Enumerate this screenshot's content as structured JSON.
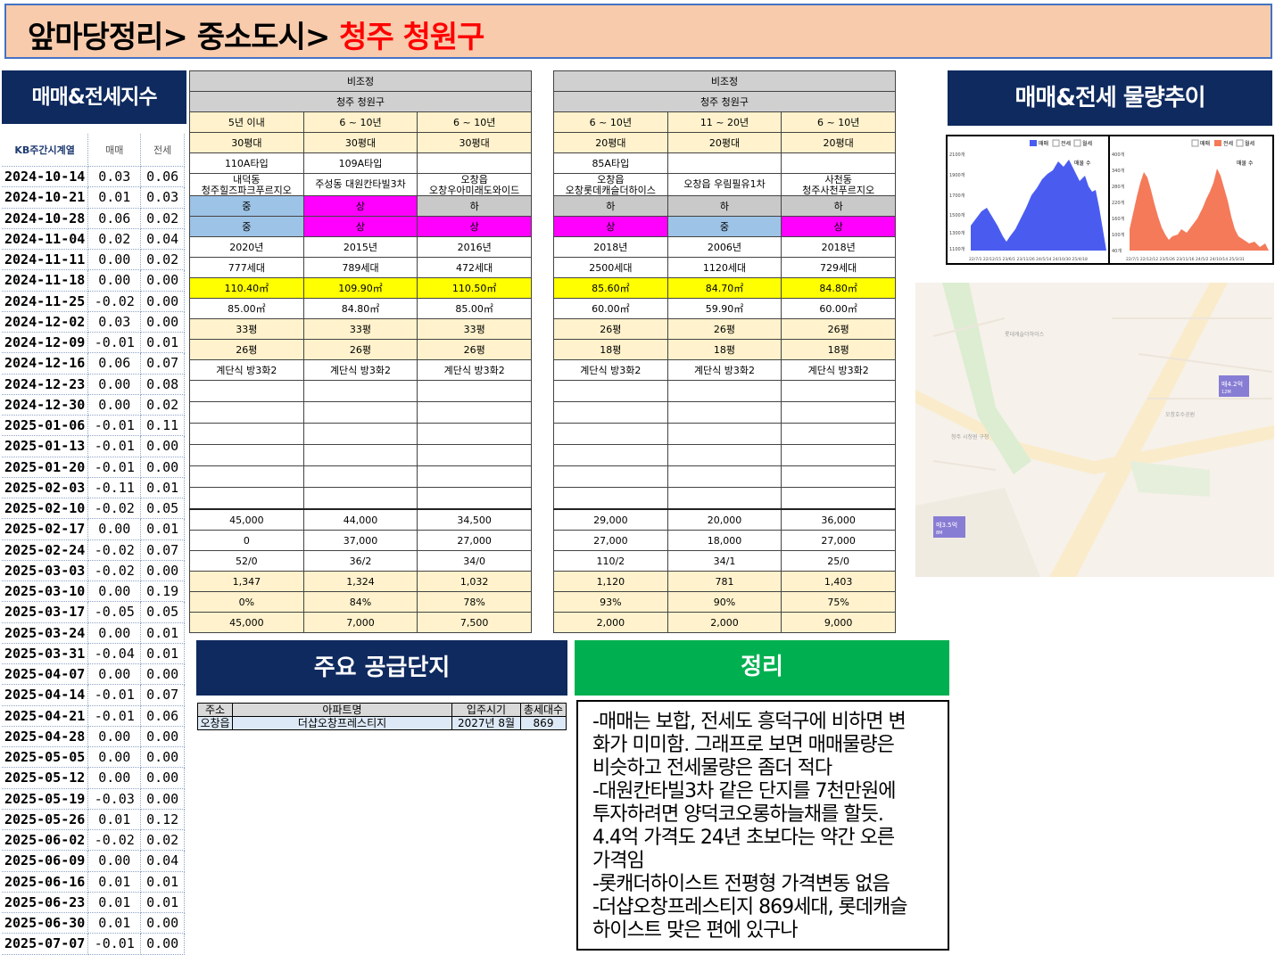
{
  "title": {
    "prefix": "앞마당정리> 중소도시> ",
    "highlight": "청주 청원구"
  },
  "index_panel": {
    "header": "매매&전세지수",
    "columns": [
      "KB주간시계열",
      "매매",
      "전세"
    ],
    "rows": [
      [
        "2024-10-14",
        "0.03",
        "0.06"
      ],
      [
        "2024-10-21",
        "0.01",
        "0.03"
      ],
      [
        "2024-10-28",
        "0.06",
        "0.02"
      ],
      [
        "2024-11-04",
        "0.02",
        "0.04"
      ],
      [
        "2024-11-11",
        "0.00",
        "0.02"
      ],
      [
        "2024-11-18",
        "0.00",
        "0.00"
      ],
      [
        "2024-11-25",
        "-0.02",
        "0.00"
      ],
      [
        "2024-12-02",
        "0.03",
        "0.00"
      ],
      [
        "2024-12-09",
        "-0.01",
        "0.01"
      ],
      [
        "2024-12-16",
        "0.06",
        "0.07"
      ],
      [
        "2024-12-23",
        "0.00",
        "0.08"
      ],
      [
        "2024-12-30",
        "0.00",
        "0.02"
      ],
      [
        "2025-01-06",
        "-0.01",
        "0.11"
      ],
      [
        "2025-01-13",
        "-0.01",
        "0.00"
      ],
      [
        "2025-01-20",
        "-0.01",
        "0.00"
      ],
      [
        "2025-02-03",
        "-0.11",
        "0.01"
      ],
      [
        "2025-02-10",
        "-0.02",
        "0.05"
      ],
      [
        "2025-02-17",
        "0.00",
        "0.01"
      ],
      [
        "2025-02-24",
        "-0.02",
        "0.07"
      ],
      [
        "2025-03-03",
        "-0.02",
        "0.00"
      ],
      [
        "2025-03-10",
        "0.00",
        "0.19"
      ],
      [
        "2025-03-17",
        "-0.05",
        "0.05"
      ],
      [
        "2025-03-24",
        "0.00",
        "0.01"
      ],
      [
        "2025-03-31",
        "-0.04",
        "0.01"
      ],
      [
        "2025-04-07",
        "0.00",
        "0.00"
      ],
      [
        "2025-04-14",
        "-0.01",
        "0.07"
      ],
      [
        "2025-04-21",
        "-0.01",
        "0.06"
      ],
      [
        "2025-04-28",
        "0.00",
        "0.00"
      ],
      [
        "2025-05-05",
        "0.00",
        "0.00"
      ],
      [
        "2025-05-12",
        "0.00",
        "0.00"
      ],
      [
        "2025-05-19",
        "-0.03",
        "0.00"
      ],
      [
        "2025-05-26",
        "0.01",
        "0.12"
      ],
      [
        "2025-06-02",
        "-0.02",
        "0.02"
      ],
      [
        "2025-06-09",
        "0.00",
        "0.04"
      ],
      [
        "2025-06-16",
        "0.01",
        "0.01"
      ],
      [
        "2025-06-23",
        "0.01",
        "0.01"
      ],
      [
        "2025-06-30",
        "0.01",
        "0.00"
      ],
      [
        "2025-07-07",
        "-0.01",
        "0.00"
      ]
    ]
  },
  "compare_a": {
    "group": "비조정",
    "region": "청주 청원구",
    "age": [
      "5년 이내",
      "6 ~ 10년",
      "6 ~ 10년"
    ],
    "size": [
      "30평대",
      "30평대",
      "30평대"
    ],
    "type": [
      "110A타입",
      "109A타입",
      ""
    ],
    "dong": [
      "내덕동",
      "주성동 대원칸타빌3차",
      "오창읍"
    ],
    "name": [
      "청주힐즈파크푸르지오",
      "",
      "오창우아미래도와이드"
    ],
    "grade1": [
      "중",
      "상",
      "하"
    ],
    "grade2": [
      "중",
      "상",
      "상"
    ],
    "year": [
      "2020년",
      "2015년",
      "2016년"
    ],
    "households": [
      "777세대",
      "789세대",
      "472세대"
    ],
    "supply_area": [
      "110.40㎡",
      "109.90㎡",
      "110.50㎡"
    ],
    "exclusive_area": [
      "85.00㎡",
      "84.80㎡",
      "85.00㎡"
    ],
    "supply_pyeong": [
      "33평",
      "33평",
      "33평"
    ],
    "exclusive_pyeong": [
      "26평",
      "26평",
      "26평"
    ],
    "structure": [
      "계단식 방3화2",
      "계단식 방3화2",
      "계단식 방3화2"
    ],
    "sale": [
      "45,000",
      "44,000",
      "34,500"
    ],
    "jeonse": [
      "0",
      "37,000",
      "27,000"
    ],
    "listings": [
      "52/0",
      "36/2",
      "34/0"
    ],
    "price_per": [
      "1,347",
      "1,324",
      "1,032"
    ],
    "ratio": [
      "0%",
      "84%",
      "78%"
    ],
    "gap": [
      "45,000",
      "7,000",
      "7,500"
    ]
  },
  "compare_b": {
    "group": "비조정",
    "region": "청주 청원구",
    "age": [
      "6 ~ 10년",
      "11 ~ 20년",
      "6 ~ 10년"
    ],
    "size": [
      "20평대",
      "20평대",
      "20평대"
    ],
    "type": [
      "85A타입",
      "",
      ""
    ],
    "dong": [
      "오창읍",
      "오창읍 우림필유1차",
      "사천동"
    ],
    "name": [
      "오창롯데캐슬더하이스",
      "",
      "청주사천푸르지오"
    ],
    "grade1": [
      "하",
      "하",
      "하"
    ],
    "grade2": [
      "상",
      "중",
      "상"
    ],
    "year": [
      "2018년",
      "2006년",
      "2018년"
    ],
    "households": [
      "2500세대",
      "1120세대",
      "729세대"
    ],
    "supply_area": [
      "85.60㎡",
      "84.70㎡",
      "84.80㎡"
    ],
    "exclusive_area": [
      "60.00㎡",
      "59.90㎡",
      "60.00㎡"
    ],
    "supply_pyeong": [
      "26평",
      "26평",
      "26평"
    ],
    "exclusive_pyeong": [
      "18평",
      "18평",
      "18평"
    ],
    "structure": [
      "계단식 방3화2",
      "계단식 방3화2",
      "계단식 방3화2"
    ],
    "sale": [
      "29,000",
      "20,000",
      "36,000"
    ],
    "jeonse": [
      "27,000",
      "18,000",
      "27,000"
    ],
    "listings": [
      "110/2",
      "34/1",
      "25/0"
    ],
    "price_per": [
      "1,120",
      "781",
      "1,403"
    ],
    "ratio": [
      "93%",
      "90%",
      "75%"
    ],
    "gap": [
      "2,000",
      "2,000",
      "9,000"
    ]
  },
  "trend": {
    "header": "매매&전세 물량추이",
    "chart1": {
      "legend": [
        "매매",
        "전세",
        "월세"
      ],
      "series_label": "매물 수",
      "y_ticks": [
        "2100개",
        "1900개",
        "1700개",
        "1500개",
        "1300개",
        "1100개"
      ],
      "x_label": "22/7/1 22/12/15 23/6/1 23/11/26 24/5/14 24/10/30 25/4/18",
      "color": "#4a5cf0"
    },
    "chart2": {
      "legend": [
        "매매",
        "전세",
        "월세"
      ],
      "series_label": "매물 수",
      "y_ticks": [
        "400개",
        "340개",
        "280개",
        "220개",
        "160개",
        "100개",
        "40개"
      ],
      "x_label": "22/7/1 22/12/12 23/5/26 23/11/16 24/5/2 24/10/14 25/3/31",
      "color": "#f47a5a"
    }
  },
  "map": {
    "pins": [
      {
        "label": "매4.2억",
        "sub": "12M"
      },
      {
        "label": "매3.5억",
        "sub": "8M"
      }
    ],
    "places": [
      "청주 시청원 구청",
      "오창호수공원",
      "롯데캐슬더하이스"
    ]
  },
  "supply": {
    "header": "주요 공급단지",
    "columns": [
      "주소",
      "아파트명",
      "입주시기",
      "총세대수"
    ],
    "rows": [
      [
        "오창읍",
        "더샵오창프레스티지",
        "2027년 8월",
        "869"
      ]
    ]
  },
  "summary": {
    "header": "정리",
    "lines": [
      "-매매는 보합, 전세도 흥덕구에 비하면 변",
      "화가 미미함. 그래프로 보면 매매물량은",
      "비슷하고 전세물량은 좀더 적다",
      "-대원칸타빌3차 같은 단지를 7천만원에",
      "투자하려면 양덕코오롱하늘채를 할듯.",
      "4.4억 가격도 24년 초보다는 약간 오른",
      "가격임",
      "-롯캐더하이스트 전평형 가격변동 없음",
      "-더샵오창프레스티지 869세대, 롯데캐슬",
      "하이스트 맞은 편에 있구나"
    ]
  }
}
